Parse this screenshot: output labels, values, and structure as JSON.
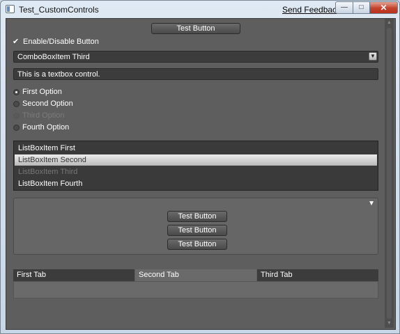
{
  "window": {
    "title": "Test_CustomControls",
    "feedback_link": "Send Feedback",
    "min_glyph": "—",
    "max_glyph": "□",
    "close_glyph": "✕"
  },
  "top_button": {
    "label": "Test Button"
  },
  "checkbox": {
    "label": "Enable/Disable Button",
    "checked": true,
    "glyph": "✔"
  },
  "combobox": {
    "selected": "ComboBoxItem Third",
    "arrow": "▼"
  },
  "textbox": {
    "value": "This is a textbox control."
  },
  "radios": [
    {
      "label": "First Option",
      "selected": true,
      "enabled": true
    },
    {
      "label": "Second Option",
      "selected": false,
      "enabled": true
    },
    {
      "label": "Third Option",
      "selected": false,
      "enabled": false
    },
    {
      "label": "Fourth Option",
      "selected": false,
      "enabled": true
    }
  ],
  "listbox": {
    "items": [
      {
        "label": "ListBoxItem First",
        "selected": false,
        "enabled": true
      },
      {
        "label": "ListBoxItem Second",
        "selected": true,
        "enabled": true
      },
      {
        "label": "ListBoxItem Third",
        "selected": false,
        "enabled": false
      },
      {
        "label": "ListBoxItem Fourth",
        "selected": false,
        "enabled": true
      }
    ]
  },
  "expander": {
    "arrow": "▼",
    "buttons": [
      "Test Button",
      "Test Button",
      "Test Button"
    ]
  },
  "tabs": [
    {
      "label": "First Tab",
      "active": false
    },
    {
      "label": "Second Tab",
      "active": true
    },
    {
      "label": "Third Tab",
      "active": false
    }
  ],
  "scrollbar": {
    "up": "▲",
    "down": "▼"
  },
  "colors": {
    "panel_bg": "#5e5e5e",
    "control_bg": "#3c3c3c",
    "selection": "#dcdcdc"
  }
}
